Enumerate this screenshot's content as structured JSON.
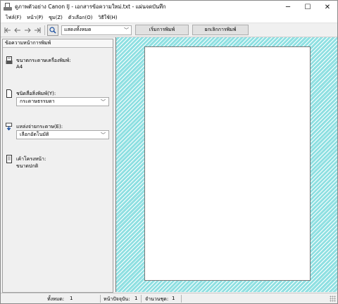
{
  "window": {
    "title": "ดูภาพตัวอย่าง Canon IJ - เอกสารข้อความใหม่.txt - แผ่นจดบันทึก",
    "minimize_glyph": "─",
    "maximize_glyph": "☐",
    "close_glyph": "✕"
  },
  "menubar": {
    "items": [
      {
        "label": "ไฟล์(F)"
      },
      {
        "label": "หน้า(P)"
      },
      {
        "label": "ซูม(Z)"
      },
      {
        "label": "ตัวเลือก(O)"
      },
      {
        "label": "วิธีใช้(H)"
      }
    ]
  },
  "toolbar": {
    "view_mode_value": "แสดงทั้งหมด",
    "start_print_label": "เริ่มการพิมพ์",
    "cancel_print_label": "ยกเลิกการพิมพ์"
  },
  "panel": {
    "header": "ข้อความหน้าการพิมพ์",
    "paper_size_label": "ขนาดกระดาษเครื่องพิมพ์:",
    "paper_size_value": "A4",
    "media_type_label": "ชนิดสื่อสิ่งพิมพ์(Y):",
    "media_type_value": "กระดาษธรรมดา",
    "paper_source_label": "แหล่งจ่ายกระดาษ(E):",
    "paper_source_value": "เลือกอัตโนมัติ",
    "page_layout_label": "เค้าโครงหน้า:",
    "page_layout_value": "ขนาดปกติ"
  },
  "statusbar": {
    "total_pages_label": "ทั้งหมด:",
    "total_pages_value": "1",
    "current_page_label": "หน้าปัจจุบัน:",
    "current_page_value": "1",
    "copies_label": "จำนวนชุด:",
    "copies_value": "1"
  },
  "colors": {
    "preview_background": "#8fe0e2",
    "accent": "#1a4fa0"
  },
  "icons": [
    "printer-app-icon",
    "first-page-icon",
    "previous-page-icon",
    "next-page-icon",
    "last-page-icon",
    "zoom-icon",
    "printer-paper-icon",
    "document-icon",
    "paper-source-icon",
    "page-layout-icon",
    "size-grip-icon"
  ]
}
